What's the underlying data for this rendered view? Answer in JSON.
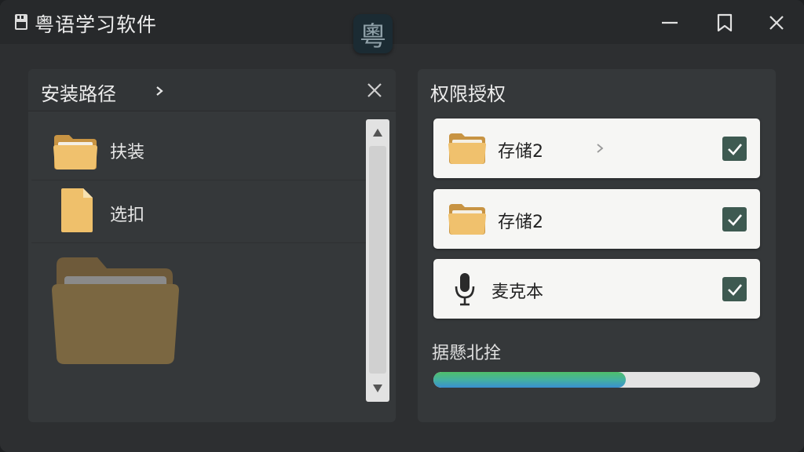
{
  "app": {
    "title": "粤语学习软件",
    "logo_char": "粵"
  },
  "left_panel": {
    "title": "安装路径",
    "items": [
      {
        "label": "扶装",
        "icon": "folder-icon"
      },
      {
        "label": "选扣",
        "icon": "document-icon"
      }
    ]
  },
  "right_panel": {
    "title": "权限授权",
    "permissions": [
      {
        "label": "存储2",
        "icon": "folder-icon",
        "checked": true
      },
      {
        "label": "存储2",
        "icon": "folder-icon",
        "checked": true
      },
      {
        "label": "麦克本",
        "icon": "microphone-icon",
        "checked": true
      }
    ],
    "progress": {
      "label": "据懸北拴",
      "value": 0.59
    }
  },
  "colors": {
    "checkbox": "#3e5a51",
    "progress_green": "#4fbf6a",
    "progress_blue": "#3a8fd0",
    "folder": "#e8b968"
  }
}
